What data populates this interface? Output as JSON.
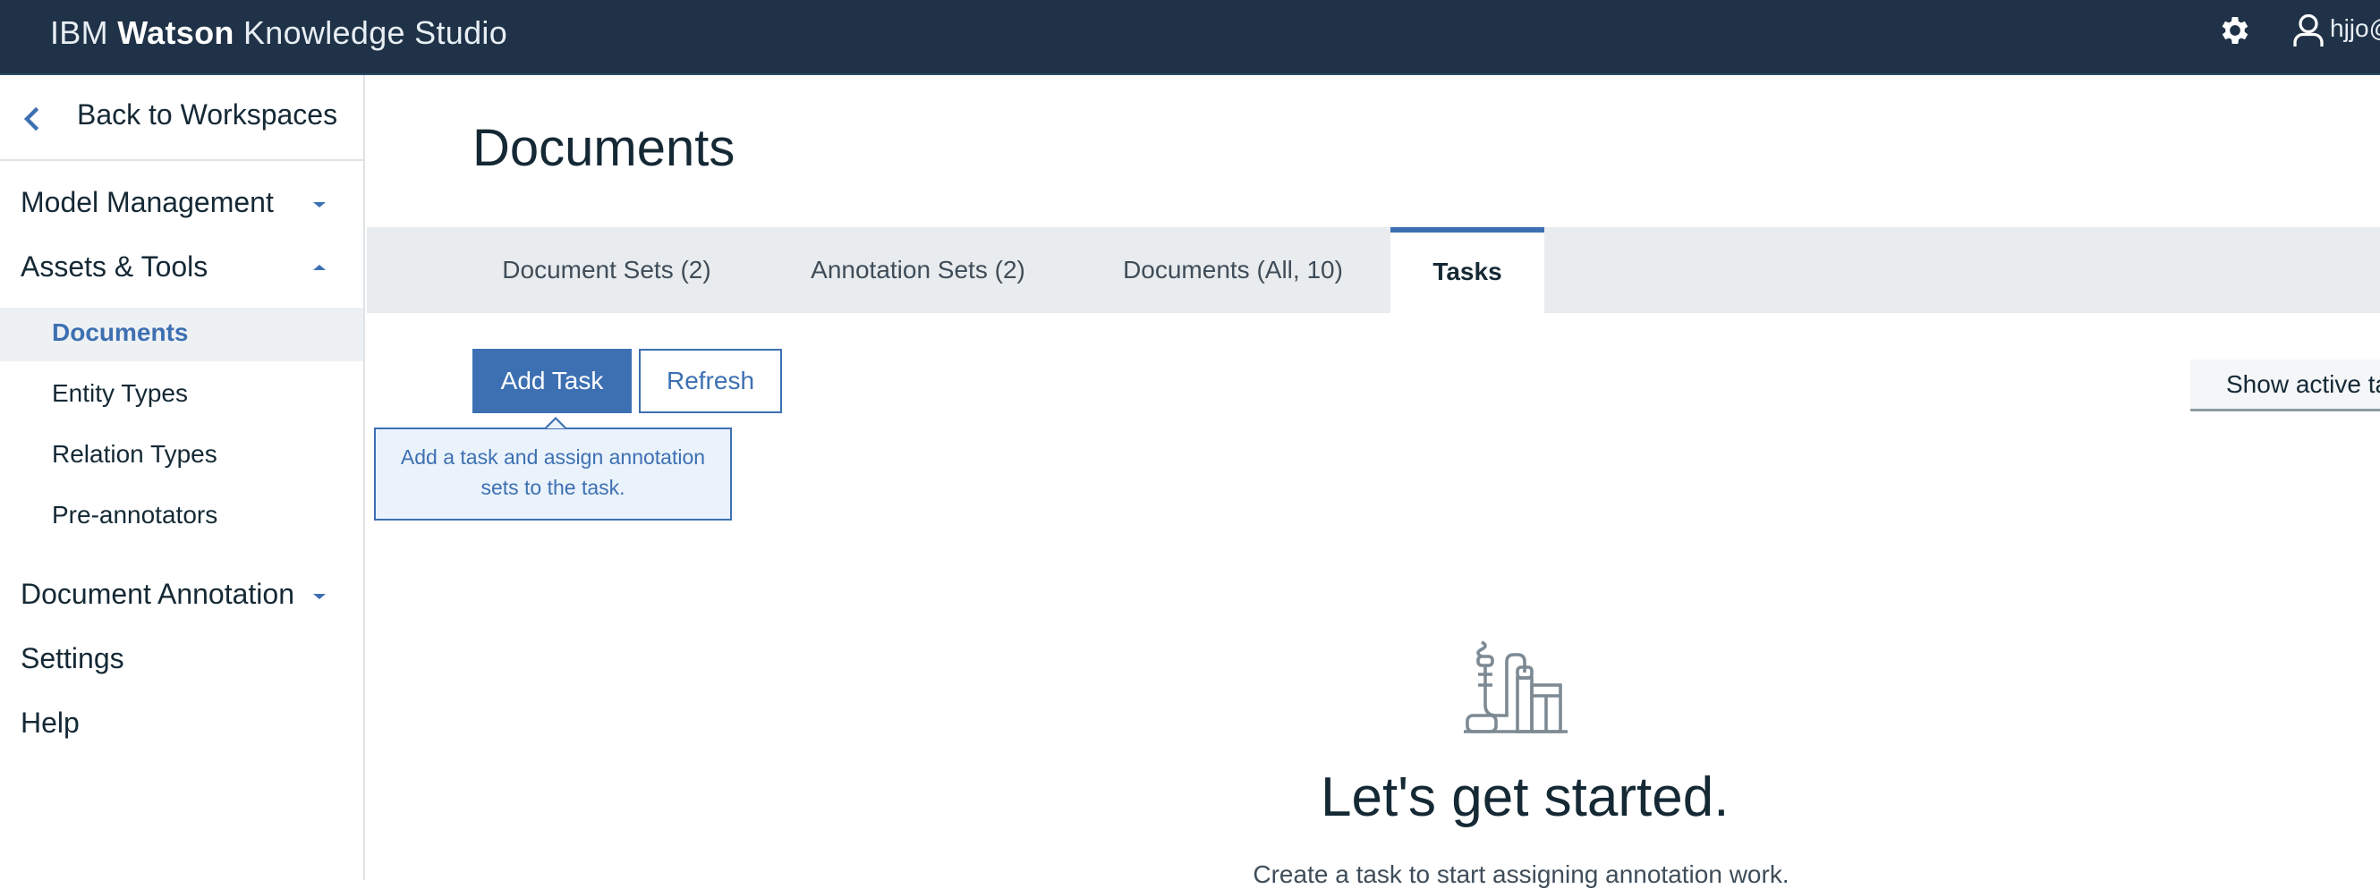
{
  "header": {
    "brand_prefix": "IBM",
    "brand_bold": "Watson",
    "brand_suffix": "Knowledge Studio",
    "user_name": "hjjo@",
    "settings_icon": "gear-icon",
    "user_icon": "user-icon",
    "background": "#1f3247"
  },
  "sidebar": {
    "back_label": "Back to Workspaces",
    "sections": [
      {
        "label": "Model Management",
        "expanded": false
      },
      {
        "label": "Assets & Tools",
        "expanded": true
      },
      {
        "label": "Document Annotation",
        "expanded": false
      },
      {
        "label": "Settings"
      },
      {
        "label": "Help"
      }
    ],
    "sub_items": [
      {
        "label": "Documents",
        "active": true
      },
      {
        "label": "Entity Types"
      },
      {
        "label": "Relation Types"
      },
      {
        "label": "Pre-annotators"
      }
    ]
  },
  "main": {
    "title": "Documents",
    "tabs": [
      {
        "label": "Document Sets (2)"
      },
      {
        "label": "Annotation Sets (2)"
      },
      {
        "label": "Documents (All, 10)"
      },
      {
        "label": "Tasks",
        "active": true
      }
    ],
    "add_task_label": "Add Task",
    "refresh_label": "Refresh",
    "tooltip": "Add a task and assign annotation sets to the task.",
    "show_active_label": "Show active ta",
    "empty_title": "Let's get started.",
    "empty_subtitle": "Create a task to start assigning annotation work.",
    "accent_color": "#3d70b2"
  }
}
